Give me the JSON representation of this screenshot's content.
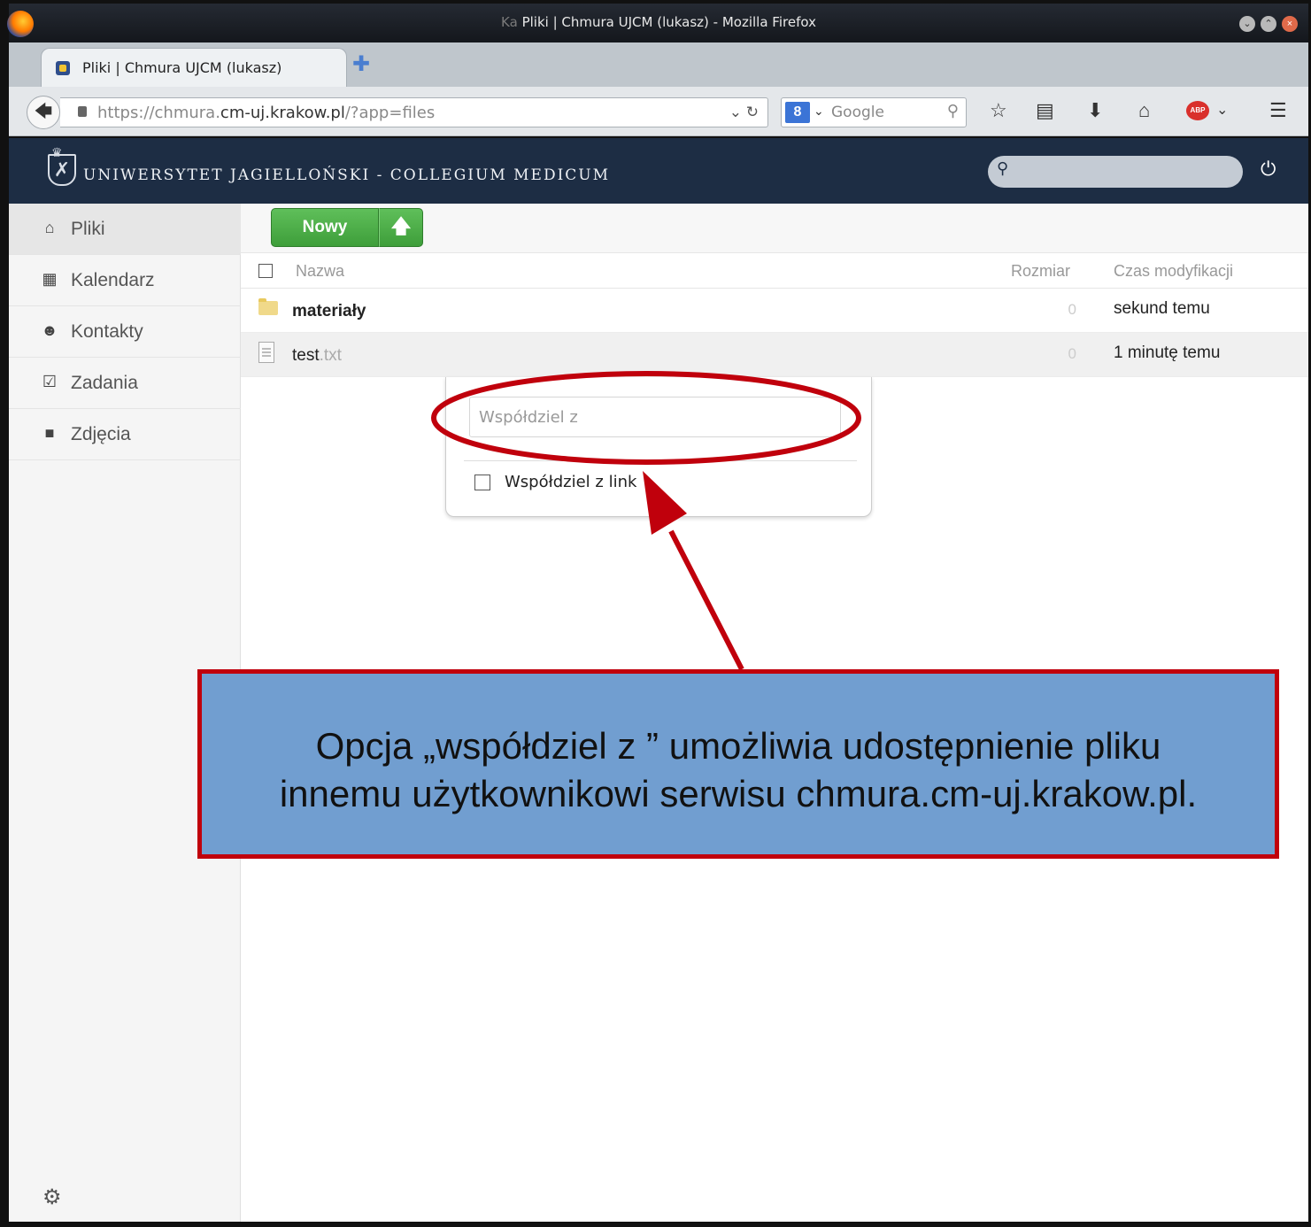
{
  "window": {
    "title_prefix": "Ka",
    "title": "Pliki | Chmura UJCM (lukasz) - Mozilla Firefox"
  },
  "tab": {
    "label": "Pliki | Chmura UJCM (lukasz)"
  },
  "address": {
    "scheme": "https://chmura.",
    "domain": "cm-uj.krakow.pl",
    "path": "/?app=files"
  },
  "search_engine": {
    "label": "Google"
  },
  "header": {
    "university": "UNIWERSYTET JAGIELLOŃSKI - COLLEGIUM MEDICUM"
  },
  "sidebar": {
    "items": [
      {
        "label": "Pliki",
        "icon": "home-icon"
      },
      {
        "label": "Kalendarz",
        "icon": "calendar-icon"
      },
      {
        "label": "Kontakty",
        "icon": "contacts-icon"
      },
      {
        "label": "Zadania",
        "icon": "tasks-icon"
      },
      {
        "label": "Zdjęcia",
        "icon": "photos-icon"
      }
    ]
  },
  "toolbar": {
    "new_label": "Nowy"
  },
  "table": {
    "headers": {
      "name": "Nazwa",
      "size": "Rozmiar",
      "modified": "Czas modyfikacji"
    },
    "rows": [
      {
        "name": "materiały",
        "ext": "",
        "size": "0",
        "modified": "sekund temu",
        "type": "folder"
      },
      {
        "name": "test",
        "ext": ".txt",
        "size": "0",
        "modified": "1 minutę temu",
        "type": "file"
      }
    ]
  },
  "share": {
    "placeholder": "Współdziel z",
    "link_label": "Współdziel z link"
  },
  "annotation": {
    "line1": "Opcja „współdziel z ” umożliwia udostępnienie pliku",
    "line2": "innemu użytkownikowi serwisu chmura.cm-uj.krakow.pl.",
    "color": "#c0000c",
    "box_color": "#719ed0"
  },
  "colors": {
    "header_bg": "#1d2d44",
    "button_green": "#4caf50"
  }
}
